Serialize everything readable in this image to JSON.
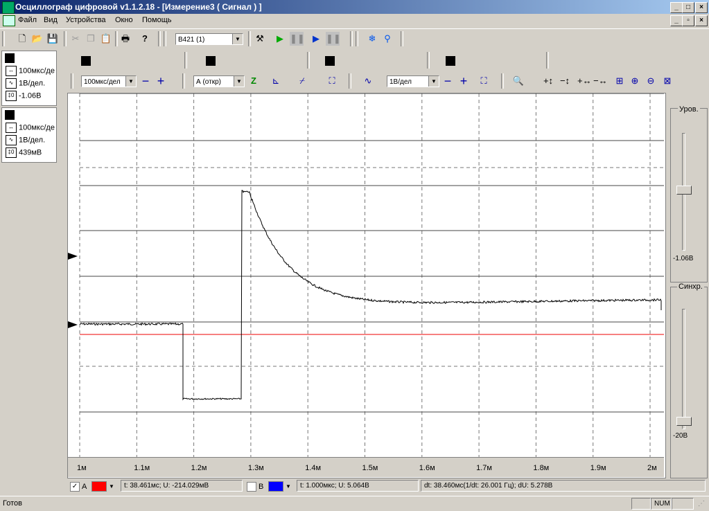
{
  "window": {
    "title": "Осциллограф цифровой v1.1.2.18 - [Измерение3 ( Сигнал ) ]"
  },
  "menu": [
    "Файл",
    "Вид",
    "Устройства",
    "Окно",
    "Помощь"
  ],
  "toolbar": {
    "device": "В421 (1)"
  },
  "controls": {
    "timebase": "100мкс/дел",
    "coupling": "А (откр)",
    "volts": "1В/дел"
  },
  "channels": [
    {
      "time": "100мкс/де",
      "volts": "1В/дел.",
      "offset": "-1.06В"
    },
    {
      "time": "100мкс/де",
      "volts": "1В/дел.",
      "offset": "439мВ"
    }
  ],
  "right_panel": {
    "level_label": "Уров.",
    "level_value": "-1.06В",
    "sync_label": "Синхр.",
    "sync_value": "-20В"
  },
  "x_axis": {
    "ticks": [
      "1м",
      "1.1м",
      "1.2м",
      "1.3м",
      "1.4м",
      "1.5м",
      "1.6м",
      "1.7м",
      "1.8м",
      "1.9м",
      "2м"
    ]
  },
  "cursors": {
    "a_label": "A",
    "a_color": "#ff0000",
    "a_readout": "t: 38.461мс; U: -214.029мВ",
    "b_label": "B",
    "b_color": "#0000ff",
    "b_readout": "t: 1.000мкс; U: 5.064В",
    "delta_readout": "dt: 38.460мс(1/dt: 26.001 Гц); dU: 5.278В"
  },
  "statusbar": {
    "text": "Готов",
    "num": "NUM"
  }
}
